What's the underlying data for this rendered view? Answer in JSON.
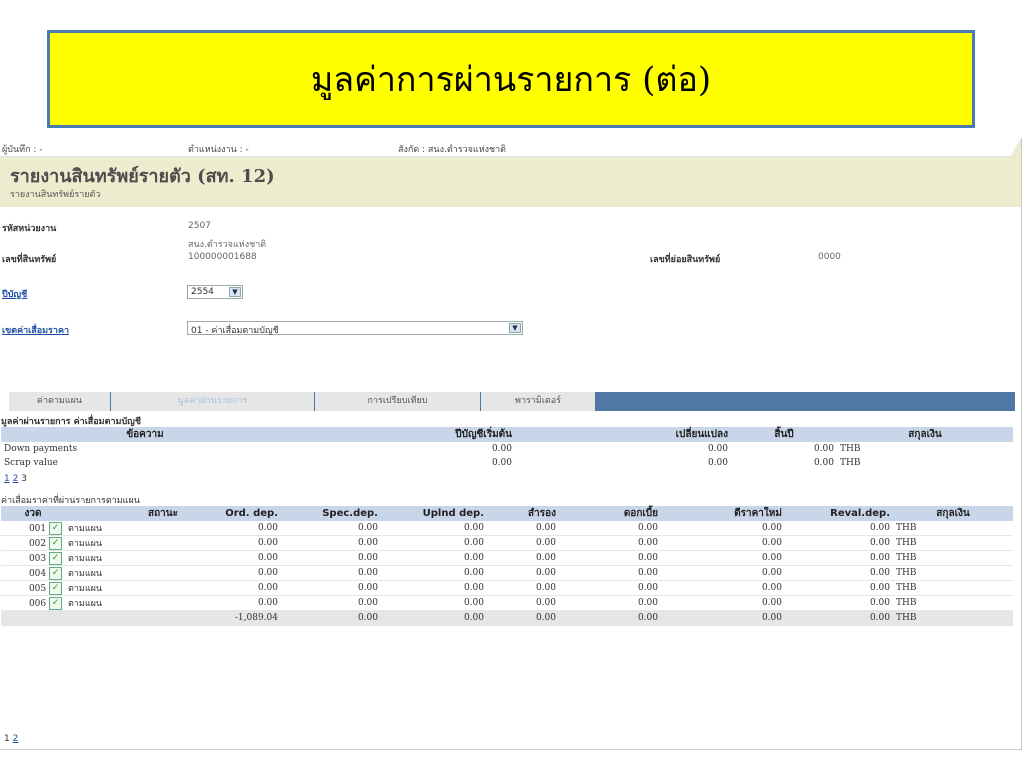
{
  "slide_title": "มูลค่าการผ่านรายการ (ต่อ)",
  "topbar": {
    "recorder": "ผู้บันทึก : -",
    "position": "ตำแหน่งงาน : -",
    "affiliation": "สังกัด : สนง.ตำรวจแห่งชาติ"
  },
  "header": {
    "title": "รายงานสินทรัพย์รายตัว (สท. 12)",
    "subtitle": "รายงานสินทรัพย์รายตัว"
  },
  "form": {
    "unit_code_label": "รหัสหน่วยงาน",
    "unit_code": "2507",
    "unit_name": "สนง.ตำรวจแห่งชาติ",
    "asset_no_label": "เลขที่สินทรัพย์",
    "asset_no": "100000001688",
    "sub_asset_label": "เลขที่ย่อยสินทรัพย์",
    "sub_asset": "0000",
    "fiscal_year_label": "ปีบัญชี",
    "fiscal_year": "2554",
    "depr_area_label": "เขตค่าเสื่อมราคา",
    "depr_area": "01 - ค่าเสื่อมตามบัญชี"
  },
  "tabs": [
    "ค่าตามแผน",
    "มูลค่าผ่านรายการ",
    "การเปรียบเทียบ",
    "พารามิเตอร์"
  ],
  "section1": {
    "title": "มูลค่าผ่านรายการ ค่าเสื่อมตามบัญชี",
    "headers": [
      "ข้อความ",
      "ปีบัญชีเริ่มต้น",
      "เปลี่ยนแปลง",
      "สิ้นปี",
      "สกุลเงิน"
    ],
    "rows": [
      [
        "Down payments",
        "0.00",
        "0.00",
        "0.00",
        "THB"
      ],
      [
        "Scrap value",
        "0.00",
        "0.00",
        "0.00",
        "THB"
      ]
    ],
    "pager": [
      "1",
      "2",
      "3"
    ]
  },
  "section2": {
    "title": "ค่าเสื่อมราคาที่ผ่านรายการตามแผน",
    "headers": [
      "งวด",
      "สถานะ",
      "Ord. dep.",
      "Spec.dep.",
      "Uplnd dep.",
      "สำรอง",
      "ดอกเบี้ย",
      "ตีราคาใหม่",
      "Reval.dep.",
      "สกุลเงิน"
    ],
    "rows": [
      [
        "001",
        "ตามแผน",
        "0.00",
        "0.00",
        "0.00",
        "0.00",
        "0.00",
        "0.00",
        "0.00",
        "THB"
      ],
      [
        "002",
        "ตามแผน",
        "0.00",
        "0.00",
        "0.00",
        "0.00",
        "0.00",
        "0.00",
        "0.00",
        "THB"
      ],
      [
        "003",
        "ตามแผน",
        "0.00",
        "0.00",
        "0.00",
        "0.00",
        "0.00",
        "0.00",
        "0.00",
        "THB"
      ],
      [
        "004",
        "ตามแผน",
        "0.00",
        "0.00",
        "0.00",
        "0.00",
        "0.00",
        "0.00",
        "0.00",
        "THB"
      ],
      [
        "005",
        "ตามแผน",
        "0.00",
        "0.00",
        "0.00",
        "0.00",
        "0.00",
        "0.00",
        "0.00",
        "THB"
      ],
      [
        "006",
        "ตามแผน",
        "0.00",
        "0.00",
        "0.00",
        "0.00",
        "0.00",
        "0.00",
        "0.00",
        "THB"
      ]
    ],
    "total": [
      "",
      "",
      "-1,089.04",
      "0.00",
      "0.00",
      "0.00",
      "0.00",
      "0.00",
      "0.00",
      "THB"
    ],
    "pager": [
      "1",
      "2"
    ]
  },
  "icons": {
    "status": "check-icon",
    "dropdown": "chevron-down-icon"
  },
  "colors": {
    "banner": "#ffff00",
    "tab_bar": "#4f78a5",
    "table_header": "#c9d6e9",
    "header_bg": "#eeeccf"
  }
}
